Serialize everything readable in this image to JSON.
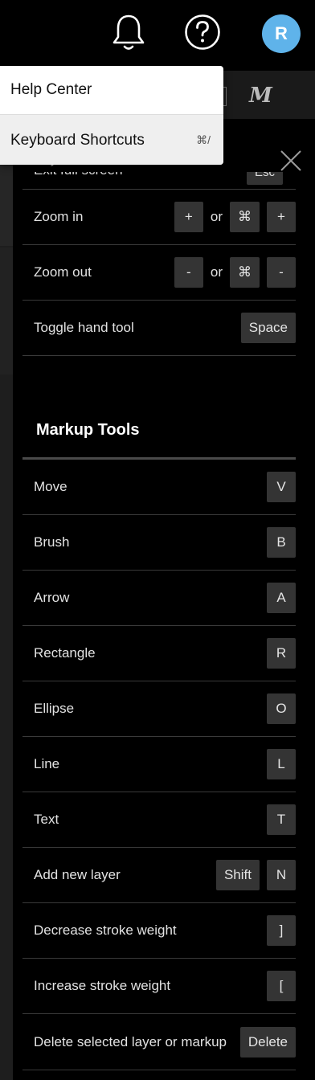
{
  "header": {
    "notifications_icon": "bell-icon",
    "help_icon": "help-circle-icon",
    "avatar_initial": "R",
    "avatar_color": "#5fb3ea"
  },
  "menu": {
    "items": [
      {
        "label": "Help Center",
        "shortcut": ""
      },
      {
        "label": "Keyboard Shortcuts",
        "shortcut": "⌘/"
      }
    ]
  },
  "background_toolbar": {
    "logo": "M"
  },
  "panel": {
    "partial_heading": "Keyboard Shortcuts",
    "partial_row": {
      "label": "Exit full screen",
      "key": "Esc"
    },
    "close_icon": "close-icon",
    "view_rows": [
      {
        "label": "Zoom in",
        "keys": [
          "+",
          "or",
          "⌘",
          "+"
        ]
      },
      {
        "label": "Zoom out",
        "keys": [
          "-",
          "or",
          "⌘",
          "-"
        ]
      },
      {
        "label": "Toggle hand tool",
        "keys": [
          "Space"
        ]
      }
    ],
    "markup_section": {
      "title": "Markup Tools",
      "rows": [
        {
          "label": "Move",
          "keys": [
            "V"
          ]
        },
        {
          "label": "Brush",
          "keys": [
            "B"
          ]
        },
        {
          "label": "Arrow",
          "keys": [
            "A"
          ]
        },
        {
          "label": "Rectangle",
          "keys": [
            "R"
          ]
        },
        {
          "label": "Ellipse",
          "keys": [
            "O"
          ]
        },
        {
          "label": "Line",
          "keys": [
            "L"
          ]
        },
        {
          "label": "Text",
          "keys": [
            "T"
          ]
        },
        {
          "label": "Add new layer",
          "keys": [
            "Shift",
            "N"
          ]
        },
        {
          "label": "Decrease stroke weight",
          "keys": [
            "]"
          ]
        },
        {
          "label": "Increase stroke weight",
          "keys": [
            "["
          ]
        },
        {
          "label": "Delete selected layer or markup",
          "keys": [
            "Delete"
          ]
        }
      ]
    }
  }
}
